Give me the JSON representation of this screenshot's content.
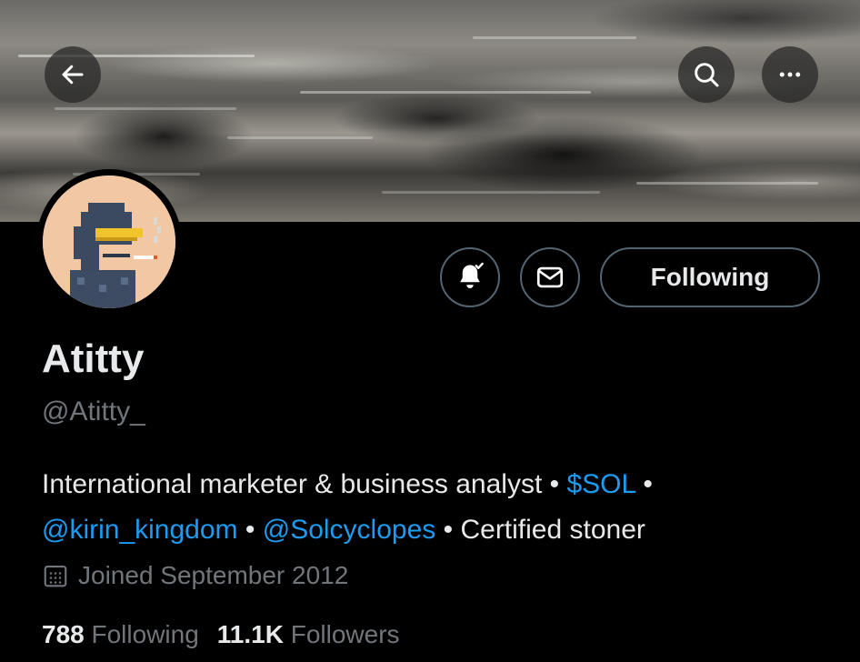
{
  "header": {
    "back_icon": "arrow-left-icon",
    "search_icon": "search-icon",
    "more_icon": "more-horizontal-icon"
  },
  "profile": {
    "name": "Atitty",
    "handle": "@Atitty_",
    "bio": {
      "part1": "International marketer & business analyst",
      "sep1": " • ",
      "cashtag": "$SOL",
      "sep2": " •",
      "mention1": "@kirin_kingdom",
      "sep3": " • ",
      "mention2": "@Solcyclopes",
      "sep4": " • ",
      "part2": "Certified stoner"
    },
    "joined": "Joined September 2012",
    "joined_icon": "calendar-icon",
    "following_count": "788",
    "following_label": "Following",
    "followers_count": "11.1K",
    "followers_label": "Followers"
  },
  "actions": {
    "notifications_icon": "bell-check-icon",
    "message_icon": "envelope-icon",
    "follow_label": "Following"
  },
  "colors": {
    "background": "#000000",
    "link": "#1d9bf0",
    "muted": "#71767b",
    "text": "#e7e9ea",
    "border": "#536471"
  }
}
